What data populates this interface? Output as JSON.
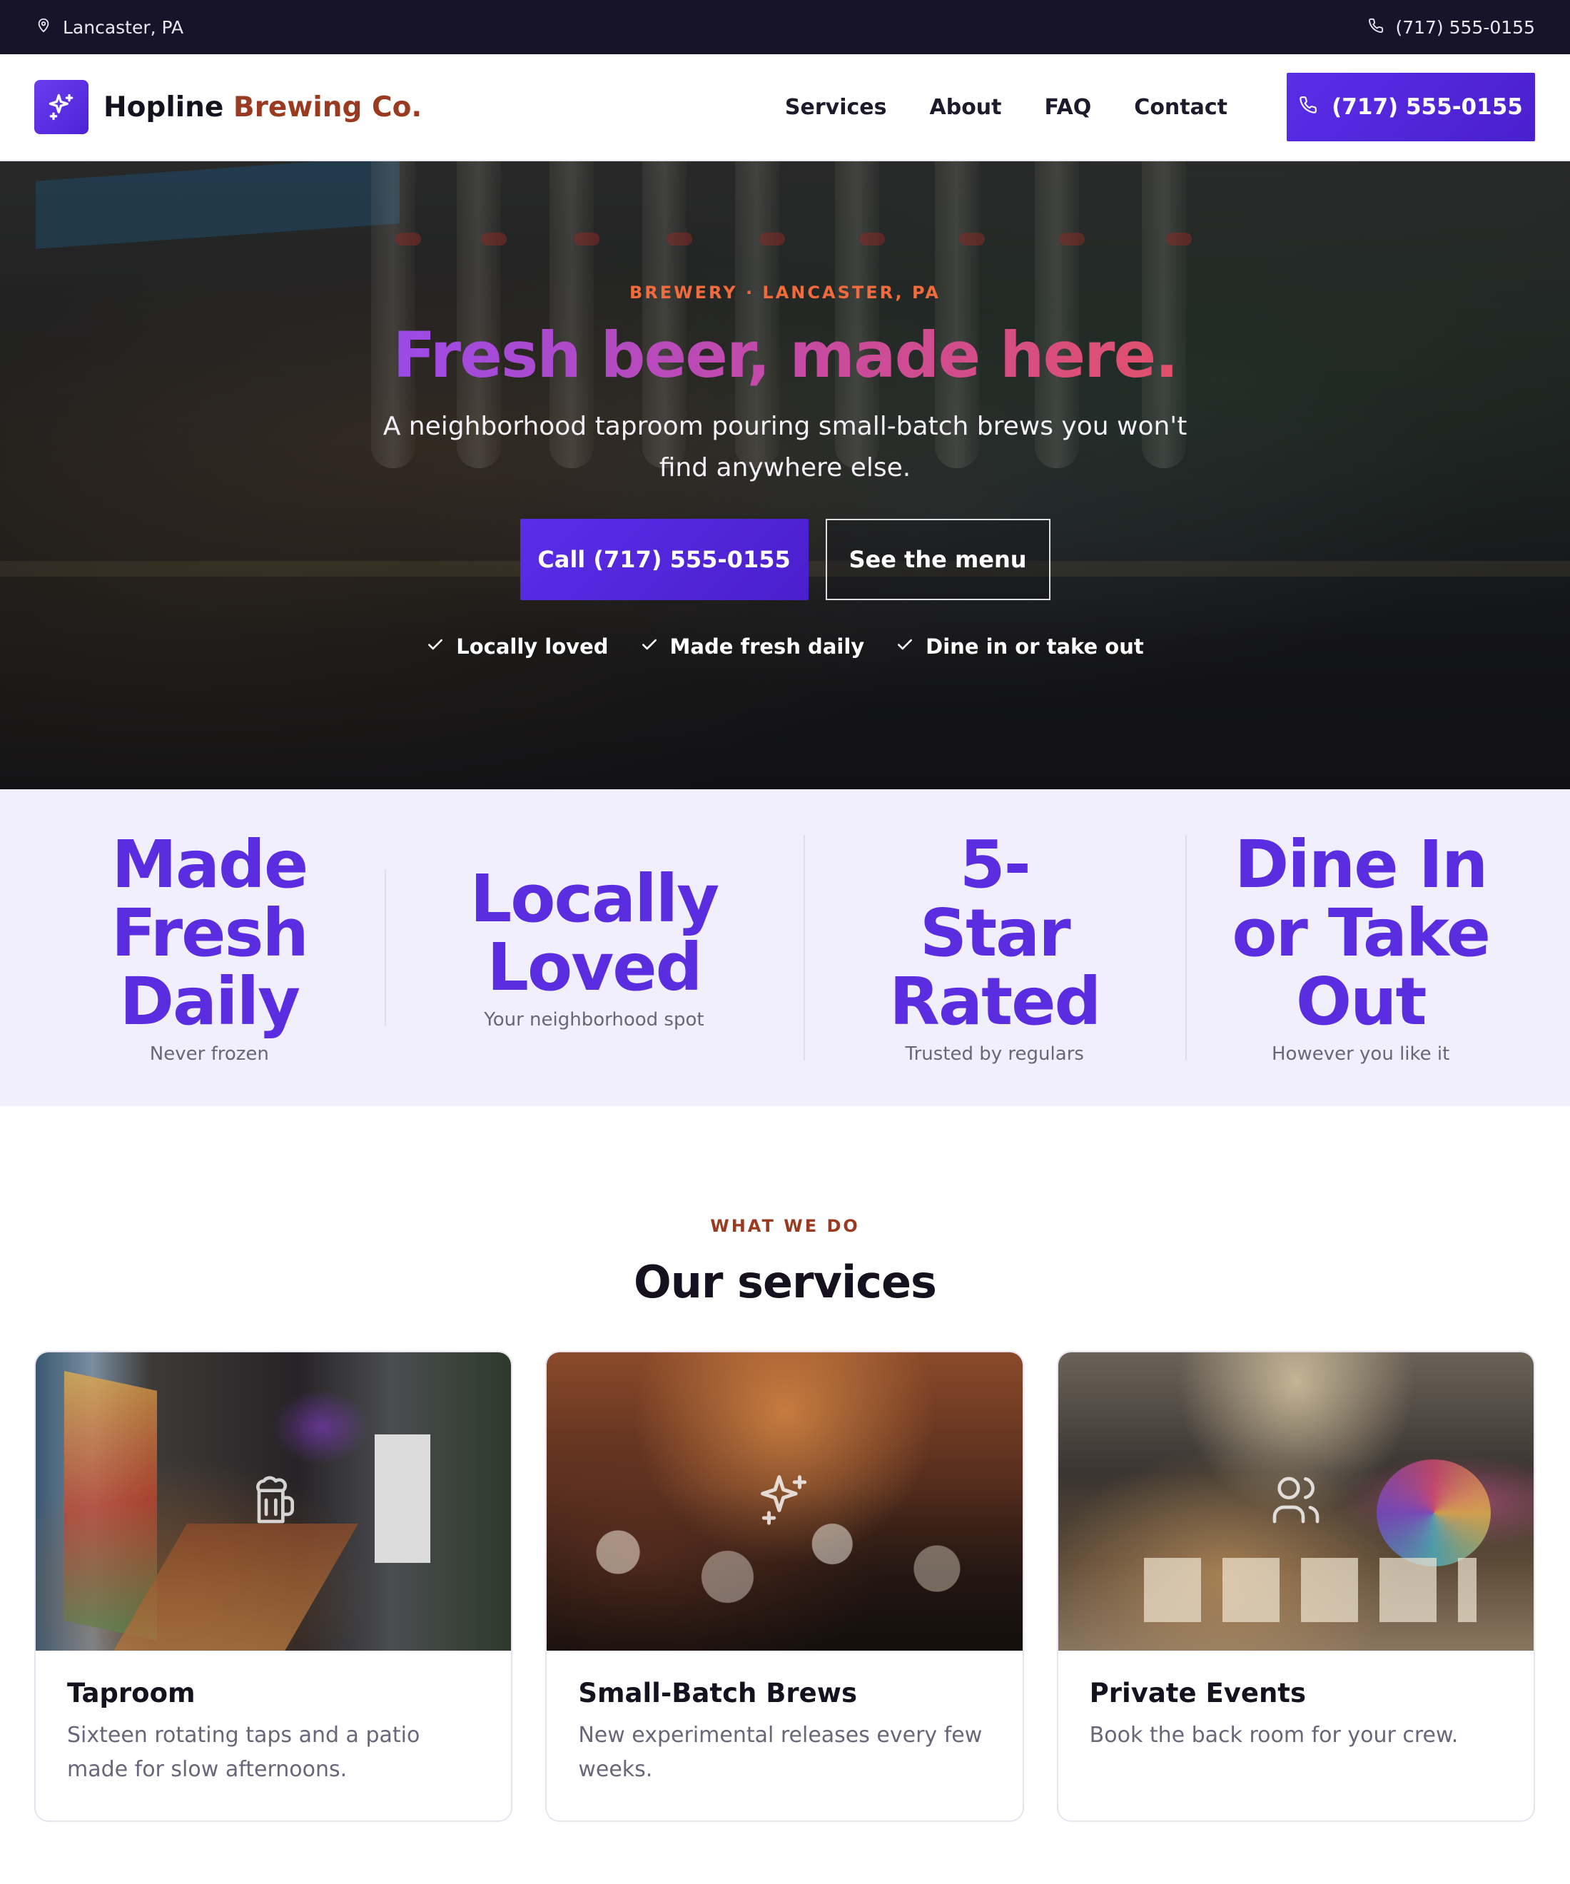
{
  "topbar": {
    "location": "Lancaster, PA",
    "phone": "(717) 555-0155"
  },
  "brand": {
    "name_part1": "Hopline",
    "name_part2": "Brewing Co."
  },
  "nav": {
    "links": [
      "Services",
      "About",
      "FAQ",
      "Contact"
    ],
    "cta_phone": "(717) 555-0155"
  },
  "hero": {
    "eyebrow": "BREWERY · LANCASTER, PA",
    "title": "Fresh beer, made here.",
    "subtitle": "A neighborhood taproom pouring small-batch brews you won't find anywhere else.",
    "primary_button": "Call (717) 555-0155",
    "secondary_button": "See the menu",
    "checks": [
      "Locally loved",
      "Made fresh daily",
      "Dine in or take out"
    ]
  },
  "stats": [
    {
      "title": "Made Fresh Daily",
      "sub": "Never frozen"
    },
    {
      "title": "Locally Loved",
      "sub": "Your neighborhood spot"
    },
    {
      "title": "5-Star Rated",
      "sub": "Trusted by regulars"
    },
    {
      "title": "Dine In or Take Out",
      "sub": "However you like it"
    }
  ],
  "services": {
    "eyebrow": "WHAT WE DO",
    "title": "Our services",
    "cards": [
      {
        "title": "Taproom",
        "desc": "Sixteen rotating taps and a patio made for slow afternoons.",
        "icon": "beer-mug-icon"
      },
      {
        "title": "Small-Batch Brews",
        "desc": "New experimental releases every few weeks.",
        "icon": "sparkle-icon"
      },
      {
        "title": "Private Events",
        "desc": "Book the back room for your crew.",
        "icon": "users-icon"
      }
    ]
  },
  "colors": {
    "accent": "#5a2ee0",
    "brand_accent": "#9a3a21",
    "eyebrow_orange": "#f26b3c",
    "topbar_bg": "#17142a",
    "stats_bg": "#f1effc"
  }
}
